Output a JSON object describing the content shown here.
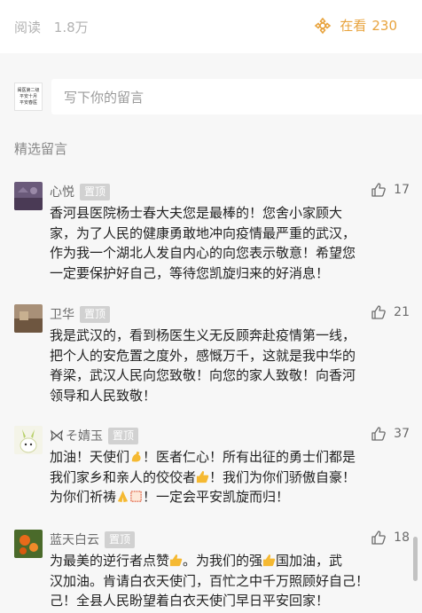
{
  "stats": {
    "read_label": "阅读",
    "read_count": "1.8万",
    "watching_label": "在看",
    "watching_count": "230"
  },
  "comment_input": {
    "placeholder": "写下你的留言",
    "avatar_lines": [
      "闽医第二级",
      "平安十月",
      "平安春医"
    ]
  },
  "section_title": "精选留言",
  "comments": [
    {
      "name": "心悦",
      "badge": "置顶",
      "likes": "17",
      "lines": [
        "香河县医院杨士春大夫您是最棒的！您舍小家顾大",
        "家，为了人民的健康勇敢地冲向疫情最严重的武汉，",
        "作为我一个湖北人发自内心的向您表示敬意！希望您",
        "一定要保护好自己，等待您凯旋归来的好消息！"
      ]
    },
    {
      "name": "卫华",
      "badge": "置顶",
      "likes": "21",
      "lines": [
        "我是武汉的，看到杨医生义无反顾奔赴疫情第一线，",
        "把个人的安危置之度外，感慨万千，这就是我中华的",
        "脊梁，武汉人民向您致敬！向您的家人致敬！向香河",
        "领导和人民致敬！"
      ]
    },
    {
      "name": "そ婧玉",
      "badge": "置顶",
      "likes": "37",
      "l1a": "加油！天使们",
      "l1b": "！医者仁心！所有出征的勇士们都是",
      "l2a": "我们家乡和亲人的佼佼者",
      "l2b": "！我们为你们骄傲自豪！",
      "l3a": "为你们祈祷",
      "l3b": "！一定会平安凯旋而归！"
    },
    {
      "name": "蓝天白云",
      "badge": "置顶",
      "likes": "18",
      "l1a": "为最美的逆行者点赞",
      "l1b": "。为我们的强",
      "l1c": "国加油，武",
      "l2": "汉加油。肯请白衣天使门，百忙之中千万照顾好自己！",
      "l3": "己！全县人民盼望着白衣天使门早日平安回家！"
    }
  ]
}
